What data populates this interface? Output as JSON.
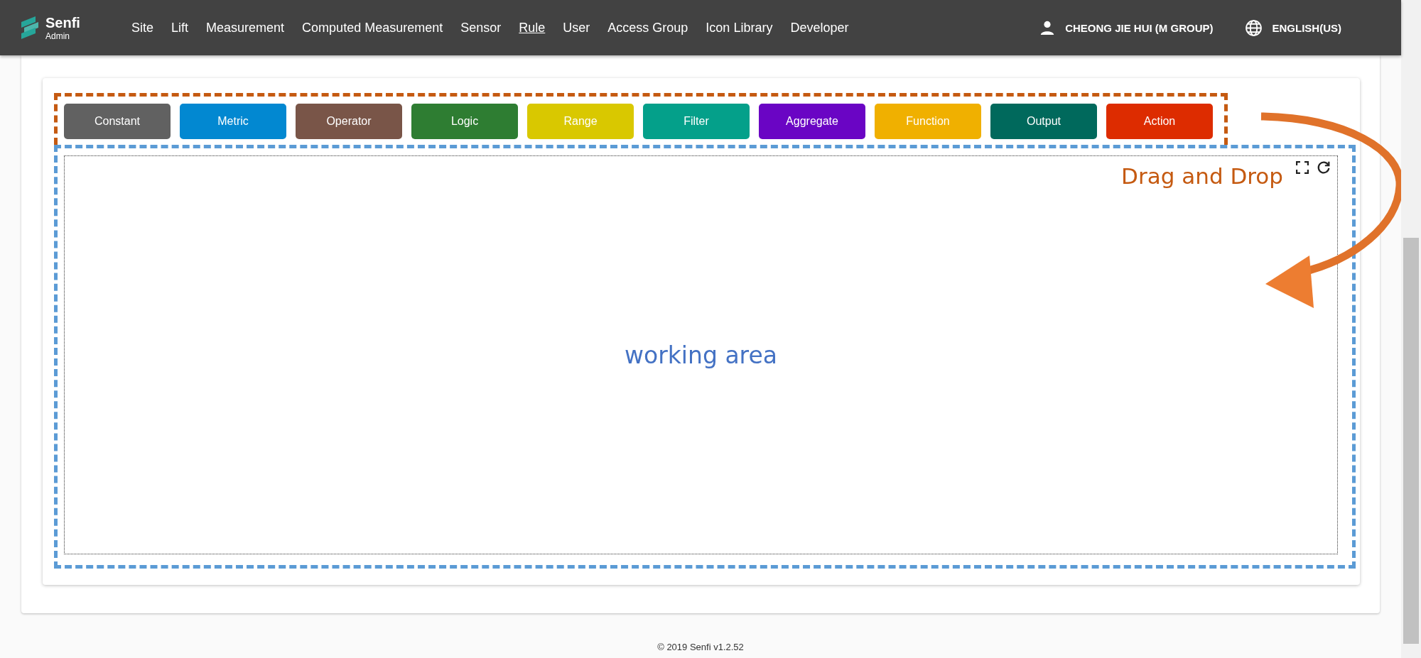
{
  "header": {
    "logo": {
      "name": "Senfi",
      "subtitle": "Admin"
    },
    "nav": [
      {
        "label": "Site",
        "selected": false
      },
      {
        "label": "Lift",
        "selected": false
      },
      {
        "label": "Measurement",
        "selected": false
      },
      {
        "label": "Computed Measurement",
        "selected": false
      },
      {
        "label": "Sensor",
        "selected": false
      },
      {
        "label": "Rule",
        "selected": true
      },
      {
        "label": "User",
        "selected": false
      },
      {
        "label": "Access Group",
        "selected": false
      },
      {
        "label": "Icon Library",
        "selected": false
      },
      {
        "label": "Developer",
        "selected": false
      }
    ],
    "user": "CHEONG JIE HUI (M GROUP)",
    "language": "ENGLISH(US)"
  },
  "palette": [
    {
      "label": "Constant",
      "color": "#616161"
    },
    {
      "label": "Metric",
      "color": "#0288d1"
    },
    {
      "label": "Operator",
      "color": "#795548"
    },
    {
      "label": "Logic",
      "color": "#2e7d32"
    },
    {
      "label": "Range",
      "color": "#d9c800"
    },
    {
      "label": "Filter",
      "color": "#04a08a"
    },
    {
      "label": "Aggregate",
      "color": "#6a05c4"
    },
    {
      "label": "Function",
      "color": "#f0b000"
    },
    {
      "label": "Output",
      "color": "#00695c"
    },
    {
      "label": "Action",
      "color": "#dd2c00"
    }
  ],
  "annotations": {
    "drag_label": "Drag and Drop",
    "area_label": "working area"
  },
  "footer": "© 2019 Senfi v1.2.52"
}
